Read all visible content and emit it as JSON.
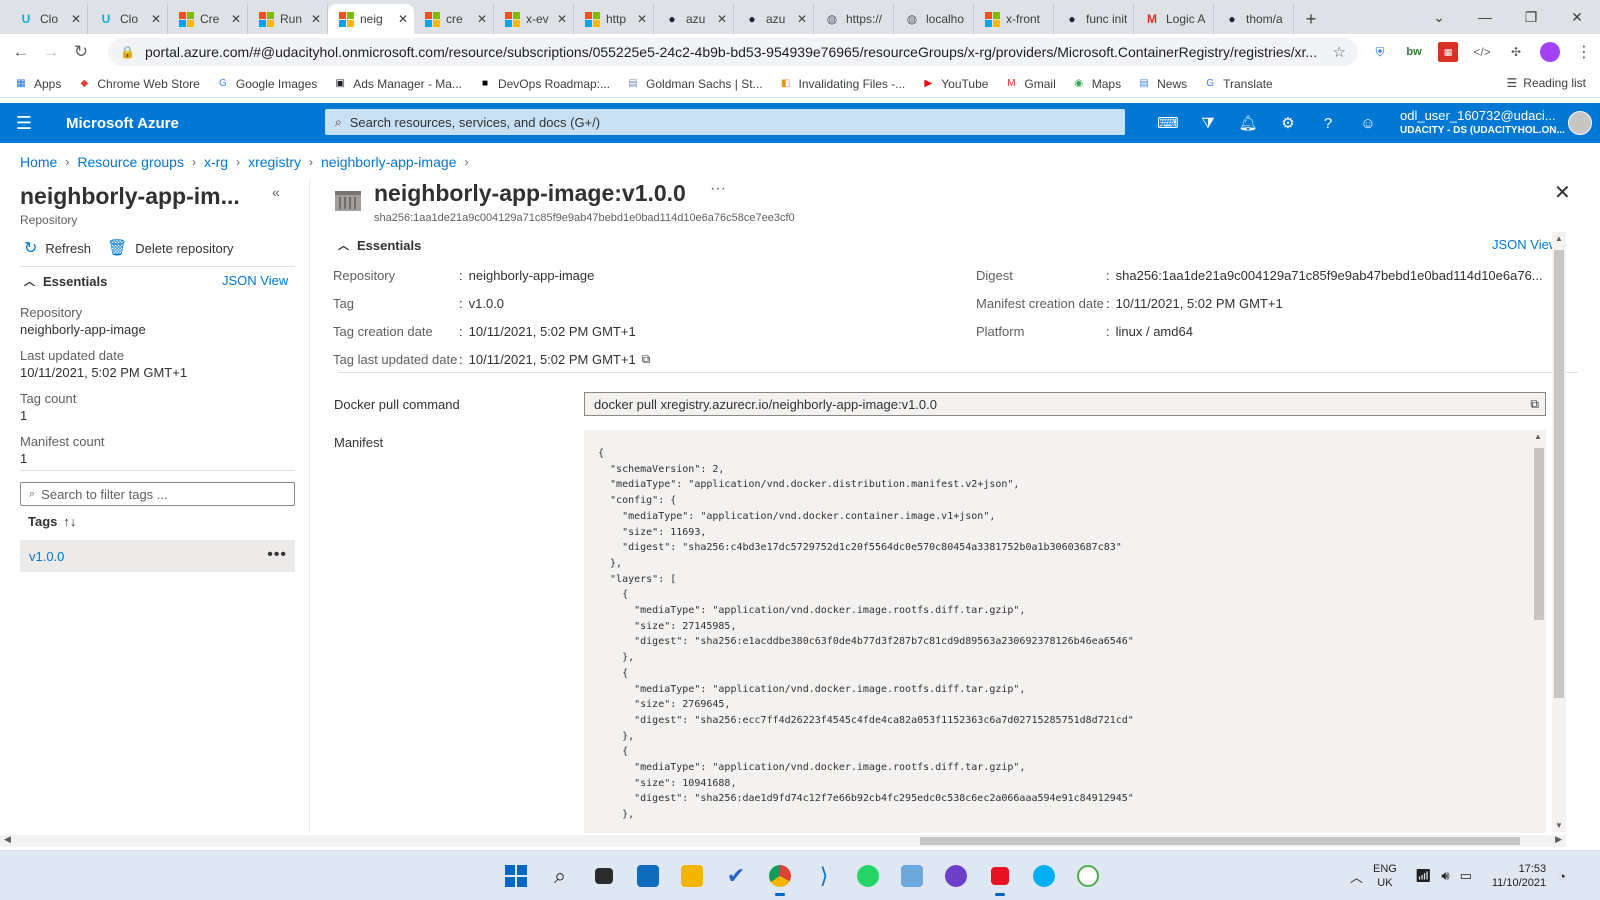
{
  "browser": {
    "tabs": [
      {
        "title": "Clo",
        "icon": "udacity-icon",
        "active": false
      },
      {
        "title": "Clo",
        "icon": "udacity-icon",
        "active": false
      },
      {
        "title": "Cre",
        "icon": "microsoft-icon",
        "active": false
      },
      {
        "title": "Run",
        "icon": "microsoft-icon",
        "active": false
      },
      {
        "title": "neig",
        "icon": "microsoft-icon",
        "active": true
      },
      {
        "title": "cre",
        "icon": "microsoft-icon",
        "active": false
      },
      {
        "title": "x-ev",
        "icon": "microsoft-icon",
        "active": false
      },
      {
        "title": "http",
        "icon": "microsoft-icon",
        "active": false
      },
      {
        "title": "azu",
        "icon": "github-icon",
        "active": false
      },
      {
        "title": "azu",
        "icon": "github-icon",
        "active": false
      },
      {
        "title": "https://",
        "icon": "globe-icon",
        "active": false
      },
      {
        "title": "localho",
        "icon": "globe-icon",
        "active": false
      },
      {
        "title": "x-front",
        "icon": "microsoft-icon",
        "active": false
      },
      {
        "title": "func init",
        "icon": "github-icon",
        "active": false
      },
      {
        "title": "Logic A",
        "icon": "gmail-icon",
        "active": false
      },
      {
        "title": "thom/a",
        "icon": "github-icon",
        "active": false
      }
    ],
    "new_tab": "+",
    "url": "portal.azure.com/#@udacityhol.onmicrosoft.com/resource/subscriptions/055225e5-24c2-4b9b-bd53-954939e76965/resourceGroups/x-rg/providers/Microsoft.ContainerRegistry/registries/xr...",
    "bookmarks": [
      {
        "label": "Apps",
        "icon": "apps-grid-icon"
      },
      {
        "label": "Chrome Web Store",
        "icon": "chrome-web-store-icon"
      },
      {
        "label": "Google Images",
        "icon": "google-icon"
      },
      {
        "label": "Ads Manager - Ma...",
        "icon": "ads-manager-icon"
      },
      {
        "label": "DevOps Roadmap:...",
        "icon": "roadmap-icon"
      },
      {
        "label": "Goldman Sachs | St...",
        "icon": "goldman-icon"
      },
      {
        "label": "Invalidating Files -...",
        "icon": "aws-icon"
      },
      {
        "label": "YouTube",
        "icon": "youtube-icon"
      },
      {
        "label": "Gmail",
        "icon": "gmail-icon"
      },
      {
        "label": "Maps",
        "icon": "maps-icon"
      },
      {
        "label": "News",
        "icon": "news-icon"
      },
      {
        "label": "Translate",
        "icon": "translate-icon"
      }
    ],
    "reading_list": "Reading list"
  },
  "azure": {
    "brand": "Microsoft Azure",
    "search_placeholder": "Search resources, services, and docs (G+/)",
    "account_user": "odl_user_160732@udaci...",
    "account_tenant": "UDACITY - DS (UDACITYHOL.ON..."
  },
  "breadcrumb": [
    "Home",
    "Resource groups",
    "x-rg",
    "xregistry",
    "neighborly-app-image"
  ],
  "left_blade": {
    "title": "neighborly-app-im...",
    "subtitle": "Repository",
    "refresh": "Refresh",
    "delete": "Delete repository",
    "essentials": "Essentials",
    "json_view": "JSON View",
    "fields": [
      {
        "key": "Repository",
        "value": "neighborly-app-image"
      },
      {
        "key": "Last updated date",
        "value": "10/11/2021, 5:02 PM GMT+1"
      },
      {
        "key": "Tag count",
        "value": "1"
      },
      {
        "key": "Manifest count",
        "value": "1"
      }
    ],
    "filter_placeholder": "Search to filter tags ...",
    "tags_header": "Tags",
    "tags": [
      "v1.0.0"
    ]
  },
  "right_blade": {
    "title": "neighborly-app-image:v1.0.0",
    "digest": "sha256:1aa1de21a9c004129a71c85f9e9ab47bebd1e0bad114d10e6a76c58ce7ee3cf0",
    "essentials": "Essentials",
    "json_view": "JSON View",
    "left_fields": [
      {
        "key": "Repository",
        "value": "neighborly-app-image"
      },
      {
        "key": "Tag",
        "value": "v1.0.0"
      },
      {
        "key": "Tag creation date",
        "value": "10/11/2021, 5:02 PM GMT+1"
      },
      {
        "key": "Tag last updated date",
        "value": "10/11/2021, 5:02 PM GMT+1"
      }
    ],
    "right_fields": [
      {
        "key": "Digest",
        "value": "sha256:1aa1de21a9c004129a71c85f9e9ab47bebd1e0bad114d10e6a76..."
      },
      {
        "key": "Manifest creation date",
        "value": "10/11/2021, 5:02 PM GMT+1"
      },
      {
        "key": "Platform",
        "value": "linux / amd64"
      }
    ],
    "pull_label": "Docker pull command",
    "pull_command": "docker pull xregistry.azurecr.io/neighborly-app-image:v1.0.0",
    "manifest_label": "Manifest",
    "manifest_text": "{\n  \"schemaVersion\": 2,\n  \"mediaType\": \"application/vnd.docker.distribution.manifest.v2+json\",\n  \"config\": {\n    \"mediaType\": \"application/vnd.docker.container.image.v1+json\",\n    \"size\": 11693,\n    \"digest\": \"sha256:c4bd3e17dc5729752d1c20f5564dc0e570c80454a3381752b0a1b30603687c83\"\n  },\n  \"layers\": [\n    {\n      \"mediaType\": \"application/vnd.docker.image.rootfs.diff.tar.gzip\",\n      \"size\": 27145985,\n      \"digest\": \"sha256:e1acddbe380c63f0de4b77d3f287b7c81cd9d89563a230692378126b46ea6546\"\n    },\n    {\n      \"mediaType\": \"application/vnd.docker.image.rootfs.diff.tar.gzip\",\n      \"size\": 2769645,\n      \"digest\": \"sha256:ecc7ff4d26223f4545c4fde4ca82a053f1152363c6a7d02715285751d8d721cd\"\n    },\n    {\n      \"mediaType\": \"application/vnd.docker.image.rootfs.diff.tar.gzip\",\n      \"size\": 10941688,\n      \"digest\": \"sha256:dae1d9fd74c12f7e66b92cb4fc295edc0c538c6ec2a066aaa594e91c84912945\"\n    },"
  },
  "taskbar": {
    "lang_line1": "ENG",
    "lang_line2": "UK",
    "time": "17:53",
    "date": "11/10/2021"
  },
  "colors": {
    "azure_blue": "#0078d4",
    "search_bg": "#c7e0f4",
    "link": "#0078d4"
  }
}
